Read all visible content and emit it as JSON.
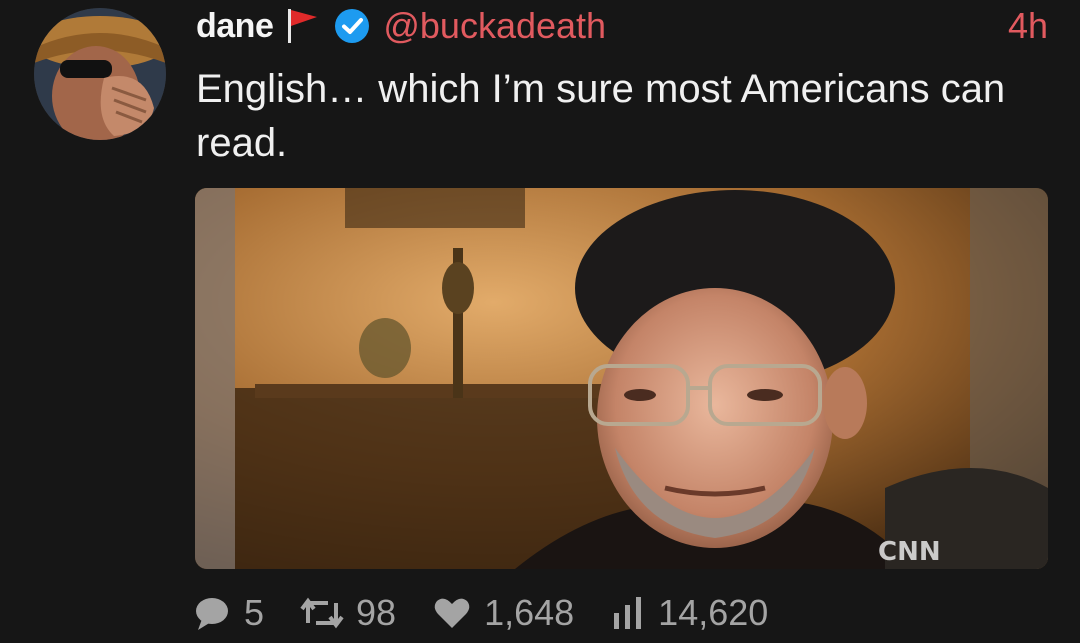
{
  "tweet": {
    "author_name": "dane",
    "handle": "@buckadeath",
    "time": "4h",
    "text": "English… which I’m sure most Americans can read.",
    "media_watermark": "CNN",
    "stats": {
      "replies": "5",
      "retweets": "98",
      "likes": "1,648",
      "views": "14,620"
    }
  },
  "icons": {
    "flag": "red-flag-icon",
    "verified": "verified-badge-icon",
    "reply": "speech-bubble-icon",
    "retweet": "retweet-icon",
    "like": "heart-icon",
    "views": "bar-chart-icon"
  },
  "colors": {
    "background": "#161616",
    "accent": "#e15a5f",
    "verified": "#1d9bf0",
    "muted": "#a4a4a4"
  }
}
